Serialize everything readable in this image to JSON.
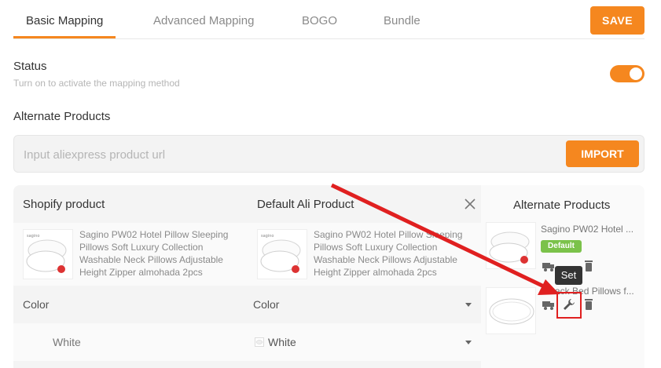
{
  "tabs": [
    {
      "label": "Basic Mapping",
      "active": true
    },
    {
      "label": "Advanced Mapping",
      "active": false
    },
    {
      "label": "BOGO",
      "active": false
    },
    {
      "label": "Bundle",
      "active": false
    }
  ],
  "save_label": "SAVE",
  "status": {
    "label": "Status",
    "hint": "Turn on to activate the mapping method",
    "enabled": true
  },
  "alternate_section_title": "Alternate Products",
  "url_input": {
    "placeholder": "Input aliexpress product url",
    "value": ""
  },
  "import_label": "IMPORT",
  "mapping": {
    "shopify_header": "Shopify product",
    "ali_header": "Default Ali Product",
    "alternate_header": "Alternate Products",
    "shopify_product_name": "Sagino PW02 Hotel Pillow Sleeping Pillows Soft Luxury Collection Washable Neck Pillows Adjustable Height Zipper almohada 2pcs",
    "ali_product_name": "Sagino PW02 Hotel Pillow Sleeping Pillows Soft Luxury Collection Washable Neck Pillows Adjustable Height Zipper almohada 2pcs",
    "option_left": "Color",
    "option_right": "Color",
    "value_left": "White",
    "value_right": "White"
  },
  "alternate_products": [
    {
      "name": "Sagino PW02 Hotel ...",
      "badge": "Default"
    },
    {
      "name": "2 Pack Bed Pillows f..."
    }
  ],
  "tooltip": "Set",
  "colors": {
    "accent": "#f5871f",
    "badge": "#7bc24a",
    "annotation": "#e02020"
  }
}
